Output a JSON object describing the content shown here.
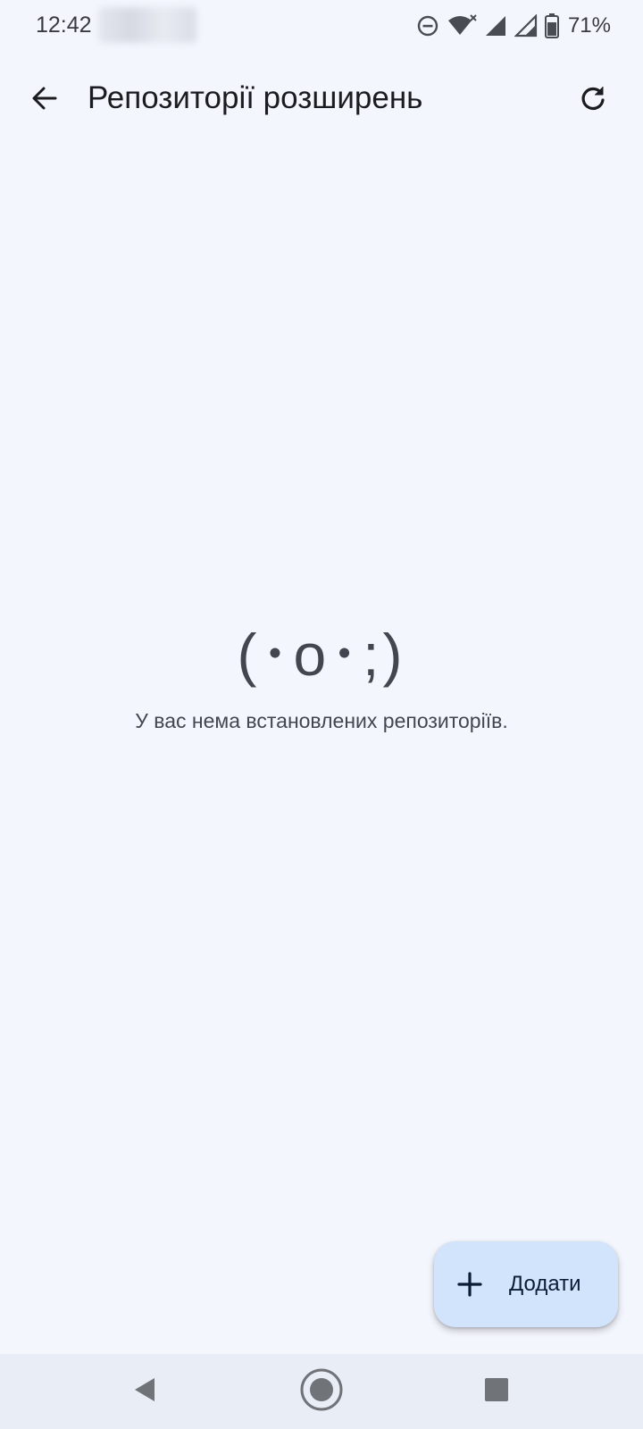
{
  "status_bar": {
    "time": "12:42",
    "battery_percent": "71%",
    "icons": [
      "dnd-icon",
      "wifi-icon",
      "signal-icon",
      "signal-icon",
      "battery-icon"
    ]
  },
  "app_bar": {
    "title": "Репозиторії розширень",
    "back_icon": "arrow-back-icon",
    "refresh_icon": "refresh-icon"
  },
  "empty_state": {
    "face": "(･o･;)",
    "message": "У вас нема встановлених репозиторіїв."
  },
  "fab": {
    "label": "Додати",
    "icon": "plus-icon"
  },
  "navigation_bar": {
    "buttons": [
      "back-triangle-icon",
      "home-circle-icon",
      "recents-square-icon"
    ]
  },
  "colors": {
    "background": "#f3f6fd",
    "fab_background": "#d2e3fc",
    "nav_background": "#e9edf5",
    "text_primary": "#1b1c20",
    "text_secondary": "#43464f"
  }
}
